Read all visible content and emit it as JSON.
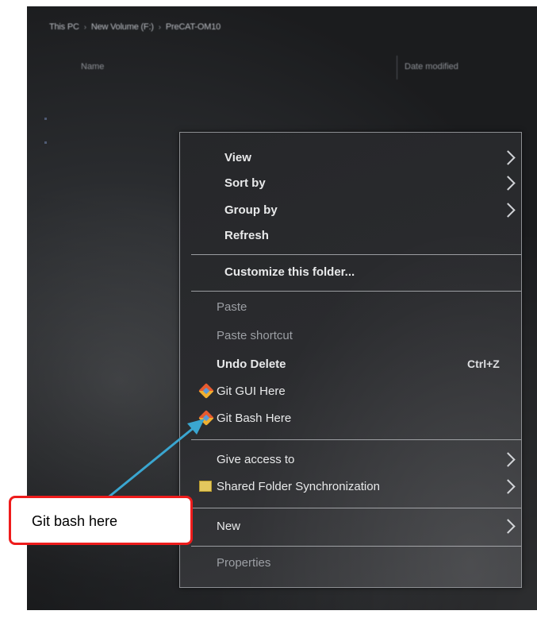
{
  "breadcrumb": [
    "This PC",
    "New Volume (F:)",
    "PreCAT-OM10"
  ],
  "columns": {
    "name": "Name",
    "date_modified": "Date modified"
  },
  "menu": {
    "view": "View",
    "sort_by": "Sort by",
    "group_by": "Group by",
    "refresh": "Refresh",
    "customize": "Customize this folder...",
    "paste": "Paste",
    "paste_shortcut": "Paste shortcut",
    "undo_delete": "Undo Delete",
    "undo_shortcut": "Ctrl+Z",
    "git_gui": "Git GUI Here",
    "git_bash": "Git Bash Here",
    "give_access": "Give access to",
    "shared_sync": "Shared Folder Synchronization",
    "new": "New",
    "properties": "Properties"
  },
  "annotation": {
    "label": "Git bash here",
    "box_color": "#ee1c1c",
    "arrow_color": "#3aa6d0"
  }
}
